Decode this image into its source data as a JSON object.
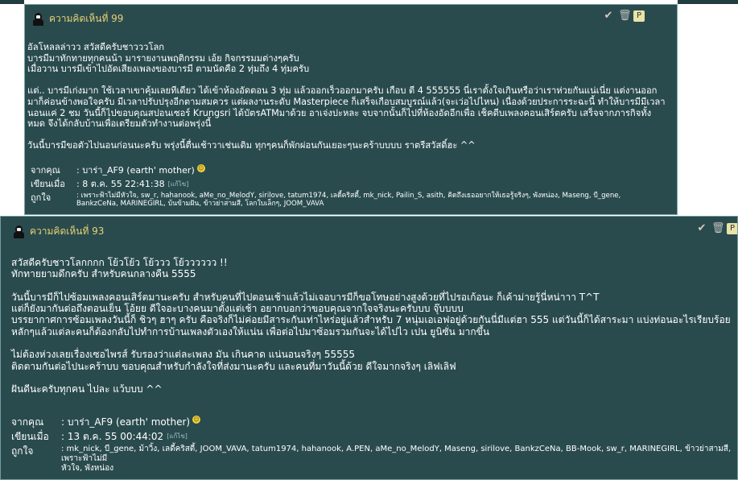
{
  "comments": [
    {
      "title": "ความคิดเห็นที่ 99",
      "body": "อัลโหลลล่าวว สวัสดีครับชาวววโลก\nบารมีมาทักทายทุกคนน้า มารายงานพฤติกรรม เอ้ย กิจกรรมมต่างๆครับ\nเมื่อวาน บารมีเข้าไปอัดเสียงเพลงของบารมี ตามนัดคือ 2 ทุ่มถึง 4 ทุ่มครับ\n\nแต่.. บารมีเก่งมาก ใช้เวลาเขาคุ้มเลยทีเดียว ได้เข้าห้องอัดตอน 3 ทุ่ม แล้วออกเร็วออกมาครับ เกือบ ตี 4 555555 นี่เราตั้งใจเกินหรือว่าเราห่วยกันแน่เนี่ย แต่งานออก\nมาก็ค่อนข้างพอใจครับ มีเวลาปรับปรุงอีกตามสมควร แต่ผลงานระดับ Masterpiece ก็เสร็จเกือบสมบูรณ์แล้ว(จะเว่อไปไหน) เนื่องด้วยประการระฉะนี้ ทำให้บารมีมีเวลา\nนอนแค่ 2 ชม วันนี้ก็ไปขอบคุณสปอนเซอร์ Krungsri ได้บัตรATMมาด้วย อาเจ่งปะหละ จบจากนั้นก็ไปที่ห้องอัดอีกเพื่อ เช็คดีบเพลงคอนเสิร์ตครับ เสร็จจากภารกิจทั้ง\nหมด จึงได้กลับบ้านเพื่อเตรียมตัวทำงานต่อพรุ่งนี้\n\nวันนี้บารมีขอตัวไปนอนก่อนนะครับ พรุ่งนี้ตื่นเช้าวาเช่นเดิม ทุกๆคนก็พักผ่อนกันเยอะๆนะคร้าบบบบ ราตรีสวัสดิ์ฮะ ^^",
      "from_label": "จากคุณ",
      "from_value": ": บาร่า_AF9 (earth' mother)",
      "written_label": "เขียนเมื่อ",
      "written_value": ": 8 ต.ค. 55 22:41:38",
      "edit_label": "[แก้ไข]",
      "like_label": "ถูกใจ",
      "like_value": ": เพราะฟ้าไม่มีหัวใจ, sw_r, hahanook, aMe_no_MelodY, sirilove, tatum1974, เลดี้คริสตี้, mk_nick, Pailin_S, asith, คิดถึงเธออยากให้เธอรู้จริงๆ, พังหน่อง, Maseng, บี_gene,\nBankzCeNa, MARINEGIRL, บ้นข้ามฝัน, ข้าวย่าสามสี, โลกใบเล็กๆ, JOOM_VAVA"
    },
    {
      "title": "ความคิดเห็นที่ 93",
      "body": "สวัสดีครับชาวโลกกกก โย้วโย้ว โย้ววว โย้วววววว !!\nทักทายยามดึกครับ สำหรับคนกลางคืน 5555\n\nวันนี้บารมีก็ไปซ้อมเพลงคอนเสิร์ตมานะครับ สำหรับคนที่ไปตอนเช้าแล้วไม่เจอบารมีก็ขอโทษอย่างสูงด้วยที่ไปรอเก้อนะ ก็เค้าม่ายรู้นี่หน่าาา T^T\nแต่ก็ยังมากันต่อถึงตอนเย็น โอ้ยย ดีใจอะบางคนมาตั้งแต่เช้า อยากบอกว่าขอบคุณจากใจจริงนะครับบบ จุ๊บบบบ\nบรรยากาศการซ้อมเพลงวันนี้ก็ ชิวๆ ฮาๆ ครับ คือจริงก็ไม่ค่อยมีสาระกันเท่าไหร่อยู่แล้วสำหรับ 7 หนุ่มเอเอฟอยู่ด้วยกันนี่มีแต่ฮา 555 แต่วันนี้ก็ได้สาระมา แบ่งท่อนอะไรเรียบร้อย\nหลักๆแล้วแต่ละคนก็ต้องกลับไปทำการบ้านเพลงตัวเองให้แน่น เพื่อต่อไปมาซ้อมรวมกันจะได้ไปไว เปน ยูนิซั่น มากขึ้น\n\nไม่ต้องห่วงเลยเรื่องเซอไพรส์ รับรองว่าแต่ละเพลง มัน เกินคาด แน่นอนจริงๆ 55555\nติดตามกันต่อไปนะคร้าบบ ขอบคุณสำหรับกำลังใจที่ส่งมานะครับ และคนที่มาวันนี้ด้วย ดีใจมากจริงๆ เลิฟเลิฟ\n\nฝันดีนะครับทุกคน ไปละ แว้บบบ ^^",
      "from_label": "จากคุณ",
      "from_value": ": บาร่า_AF9 (earth' mother)",
      "written_label": "เขียนเมื่อ",
      "written_value": ": 13 ต.ค. 55 00:44:02",
      "edit_label": "[แก้ไข]",
      "like_label": "ถูกใจ",
      "like_value": ": mk_nick, บี_gene, ม้าวิ้ง, เลดี้คริสตี้, JOOM_VAVA, tatum1974, hahanook, A.PEN, aMe_no_MelodY, Maseng, sirilove, BankzCeNa, BB-Mook, sw_r, MARINEGIRL, ข้าวย่าสามสี, เพราะฟ้าไม่มี\nหัวใจ, พังหน่อง"
    }
  ],
  "icons": [
    "quote-heart-icon",
    "delete-trash-icon",
    "report-edit-icon",
    "mascot-avatar-icon",
    "smiley-icon"
  ]
}
